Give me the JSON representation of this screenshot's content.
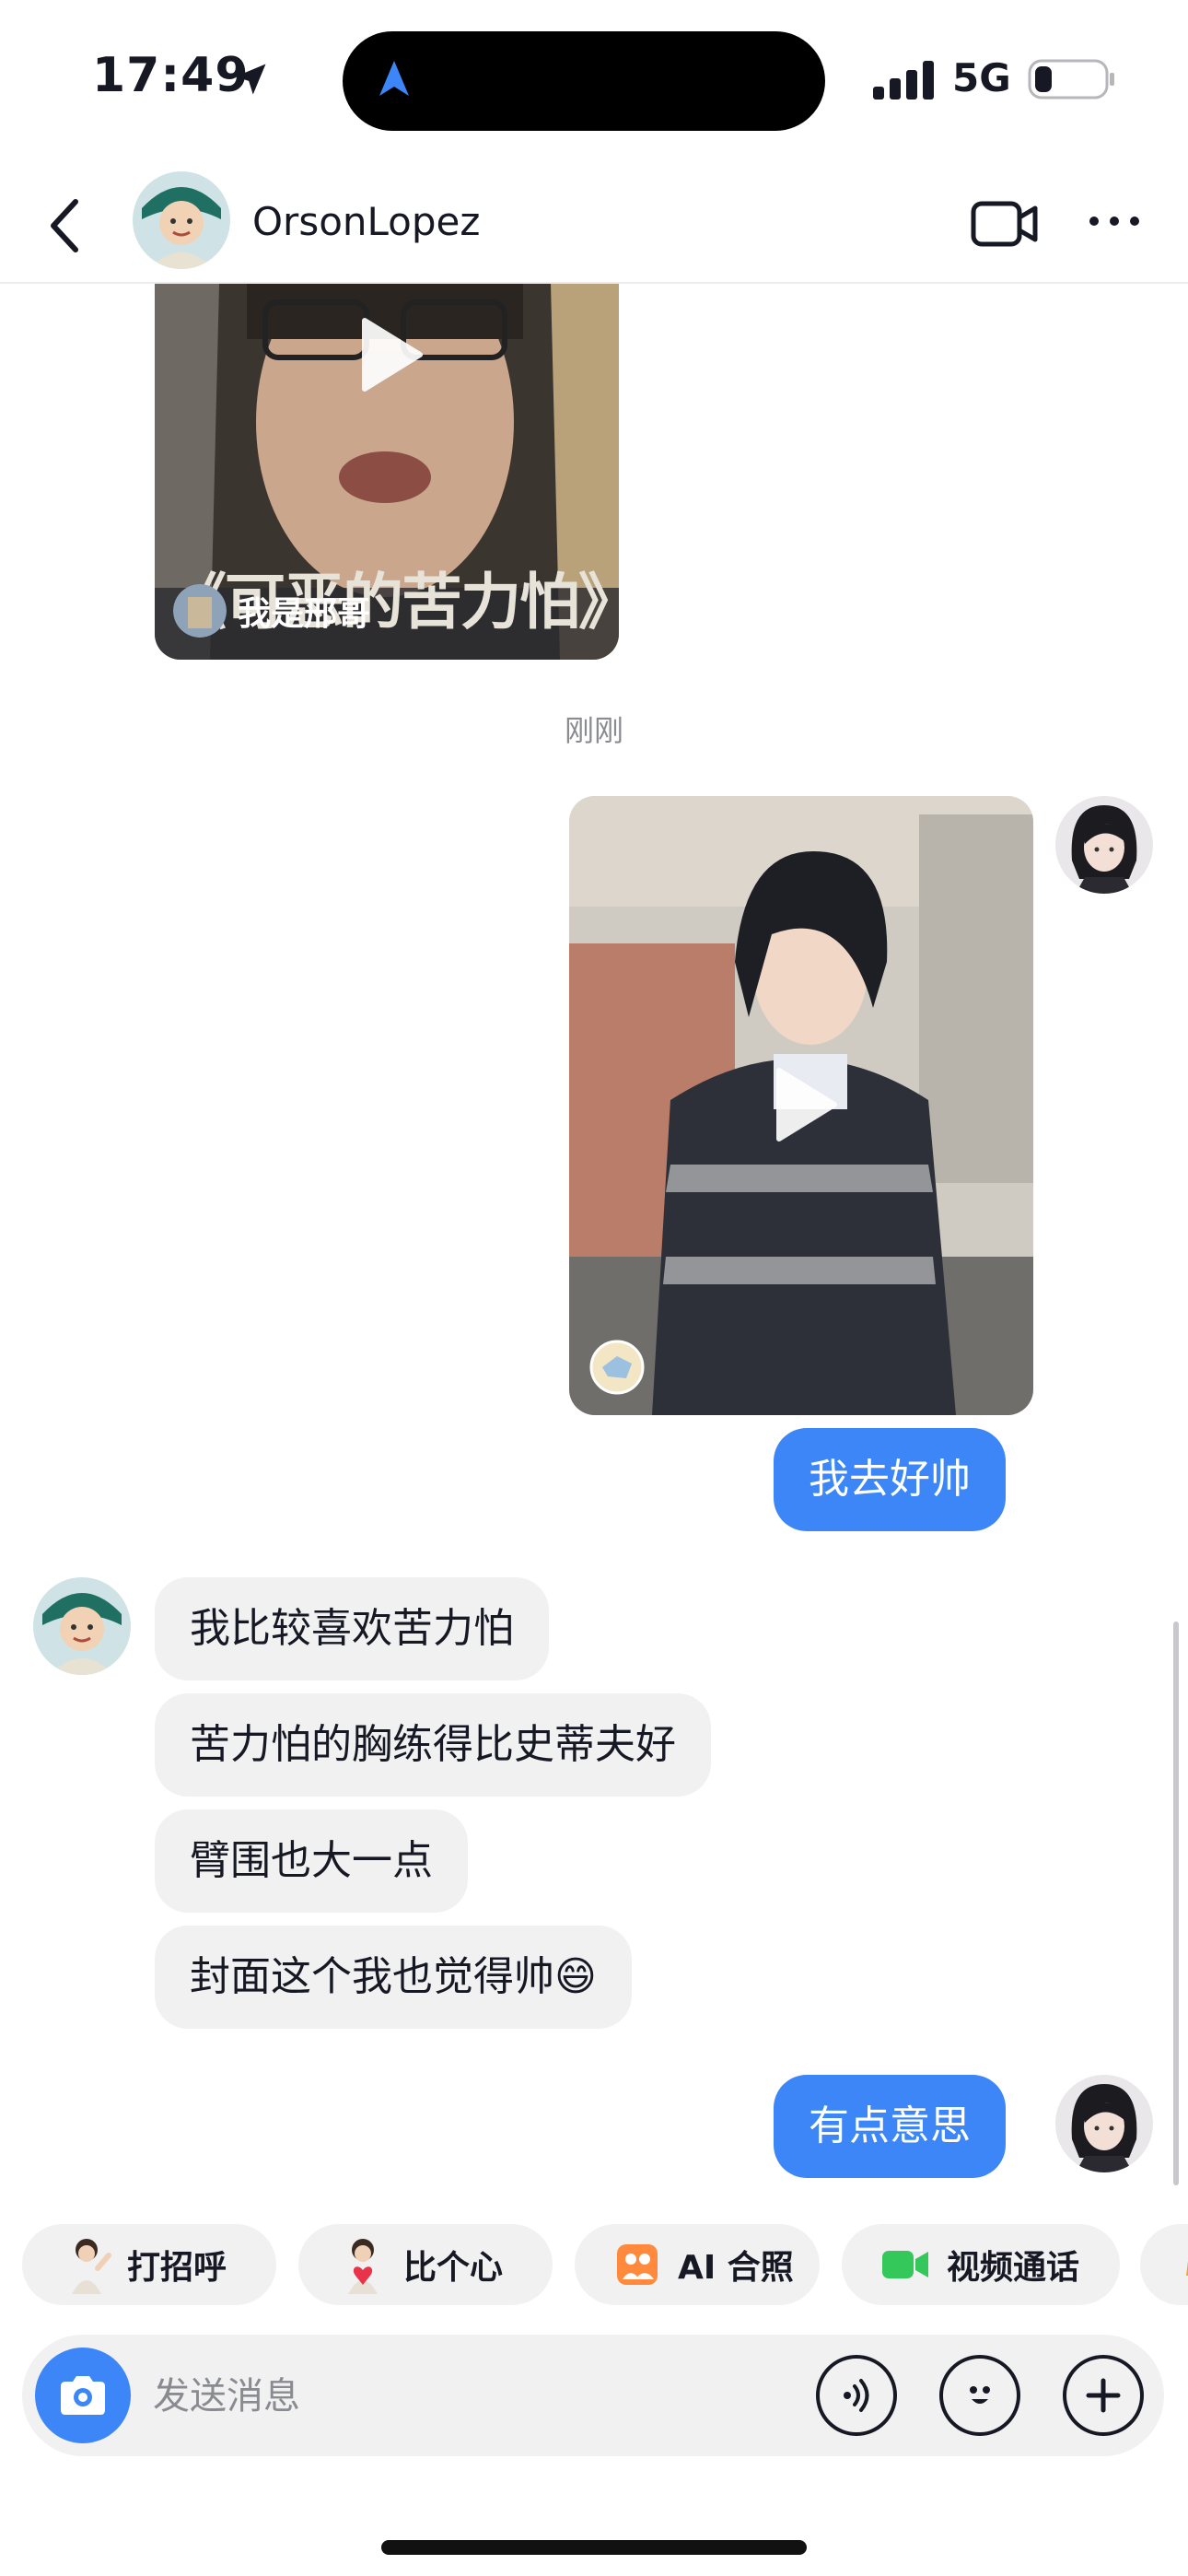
{
  "status_bar": {
    "time": "17:49",
    "network": "5G",
    "battery_level": 0.25
  },
  "header": {
    "contact_name": "OrsonLopez"
  },
  "messages": {
    "video_1": {
      "cover_caption": "《可恶的苦力怕》",
      "author": "我是邢哥"
    },
    "timestamp": "刚刚",
    "outgoing_1": "我去好帅",
    "incoming": [
      "我比较喜欢苦力怕",
      "苦力怕的胸练得比史蒂夫好",
      "臂围也大一点",
      "封面这个我也觉得帅😄"
    ],
    "outgoing_2": "有点意思"
  },
  "quick_actions": [
    "打招呼",
    "比个心",
    "AI 合照",
    "视频通话"
  ],
  "input": {
    "placeholder": "发送消息"
  },
  "colors": {
    "accent": "#3c86f8",
    "bubble_in": "#f1f1f2",
    "text": "#161823"
  }
}
